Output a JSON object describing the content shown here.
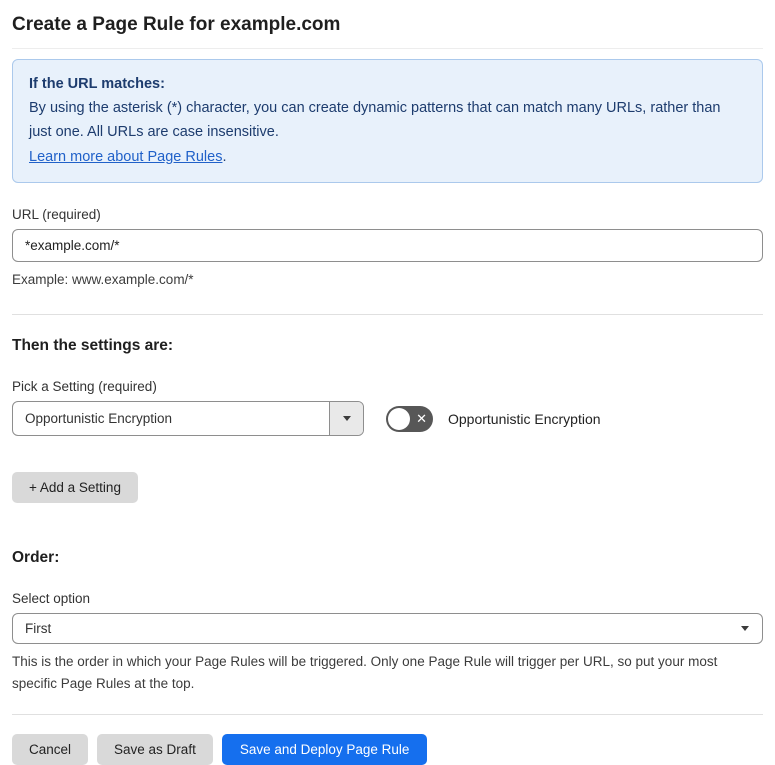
{
  "page": {
    "title": "Create a Page Rule for example.com"
  },
  "info_box": {
    "heading": "If the URL matches:",
    "body": "By using the asterisk (*) character, you can create dynamic patterns that can match many URLs, rather than just one. All URLs are case insensitive.",
    "link_label": "Learn more about Page Rules",
    "link_suffix": "."
  },
  "url_field": {
    "label": "URL (required)",
    "value": "*example.com/*",
    "helper": "Example: www.example.com/*"
  },
  "settings_section": {
    "heading": "Then the settings are:",
    "picker_label": "Pick a Setting (required)",
    "picker_value": "Opportunistic Encryption",
    "toggle": {
      "state": "off",
      "label": "Opportunistic Encryption"
    },
    "add_button_label": "+ Add a Setting"
  },
  "order_section": {
    "heading": "Order:",
    "select_label": "Select option",
    "select_value": "First",
    "helper": "This is the order in which your Page Rules will be triggered. Only one Page Rule will trigger per URL, so put your most specific Page Rules at the top."
  },
  "actions": {
    "cancel_label": "Cancel",
    "save_draft_label": "Save as Draft",
    "save_deploy_label": "Save and Deploy Page Rule"
  },
  "icons": {
    "chevron_down": "caret-down-triangle",
    "toggle_off_glyph": "✕"
  },
  "colors": {
    "info_bg": "#e8f1fb",
    "info_border": "#abc9ec",
    "info_text": "#1d3c6e",
    "link_blue": "#2061c9",
    "primary_blue": "#156fee",
    "gray_button": "#d9d9d9",
    "toggle_off_bg": "#575757",
    "input_border": "#8e8e8e"
  }
}
